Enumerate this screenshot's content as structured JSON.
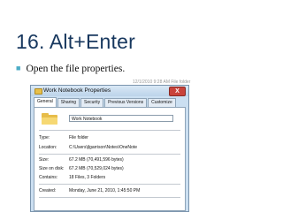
{
  "slide": {
    "title": "16. Alt+Enter",
    "bullet": "Open the file properties."
  },
  "background_text": "12/1/2010 9:28 AM      File folder",
  "dialog": {
    "title": "Work Notebook Properties",
    "close_label": "X",
    "tabs": [
      "General",
      "Sharing",
      "Security",
      "Previous Versions",
      "Customize"
    ],
    "name_value": "Work Notebook",
    "props": [
      {
        "label": "Type:",
        "value": "File folder"
      },
      {
        "label": "Location:",
        "value": "C:\\Users\\jlgarrison\\Notes\\OneNote"
      },
      {
        "label": "Size:",
        "value": "67.2 MB (70,491,596 bytes)"
      },
      {
        "label": "Size on disk:",
        "value": "67.2 MB (70,529,024 bytes)"
      },
      {
        "label": "Contains:",
        "value": "18 Files, 3 Folders"
      },
      {
        "label": "Created:",
        "value": "Monday, June 21, 2010, 1:45:50 PM"
      }
    ]
  },
  "colors": {
    "title": "#17375e",
    "bullet_marker": "#4bacc6",
    "close_button": "#c9433b",
    "window_frame": "#cbdff1"
  },
  "icons": {
    "bullet": "square-bullet-icon",
    "folder": "folder-icon",
    "close": "close-icon"
  }
}
